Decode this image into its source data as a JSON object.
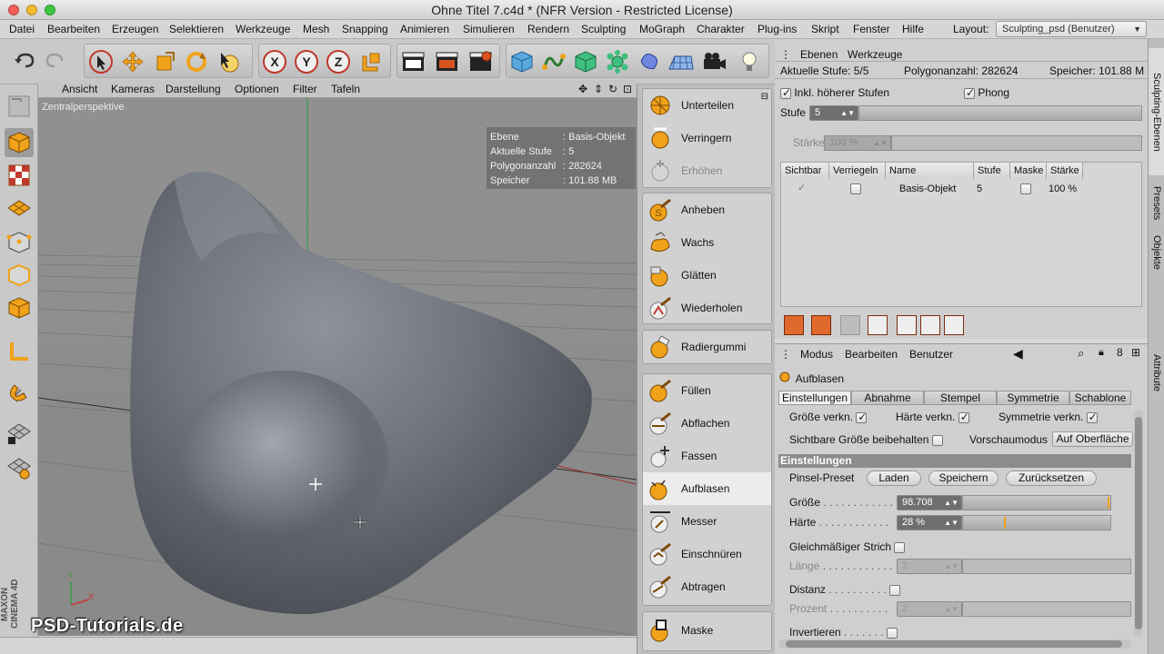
{
  "window": {
    "title": "Ohne Titel 7.c4d * (NFR Version - Restricted License)"
  },
  "menubar": {
    "items": [
      "Datei",
      "Bearbeiten",
      "Erzeugen",
      "Selektieren",
      "Werkzeuge",
      "Mesh",
      "Snapping",
      "Animieren",
      "Simulieren",
      "Rendern",
      "Sculpting",
      "MoGraph",
      "Charakter",
      "Plug-ins",
      "Skript",
      "Fenster",
      "Hilfe"
    ],
    "layout_label": "Layout:",
    "layout_value": "Sculpting_psd (Benutzer)"
  },
  "toolbar": {
    "axis_x": "X",
    "axis_y": "Y",
    "axis_z": "Z"
  },
  "viewport": {
    "menu": [
      "Ansicht",
      "Kameras",
      "Darstellung",
      "Optionen",
      "Filter",
      "Tafeln"
    ],
    "label": "Zentralperspektive",
    "hud": [
      {
        "k": "Ebene",
        "v": ": Basis-Objekt"
      },
      {
        "k": "Aktuelle Stufe",
        "v": ": 5"
      },
      {
        "k": "Polygonanzahl",
        "v": ": 282624"
      },
      {
        "k": "Speicher",
        "v": ": 101.88 MB"
      }
    ],
    "watermark": "PSD-Tutorials.de",
    "maxon": "MAXON CINEMA 4D",
    "axis_y": "Y",
    "axis_x": "X"
  },
  "palette": {
    "items": [
      {
        "label": "Unterteilen",
        "icon": "subdivide-icon"
      },
      {
        "label": "Verringern",
        "icon": "reduce-icon"
      },
      {
        "label": "Erhöhen",
        "icon": "increase-icon"
      },
      {
        "label": "Anheben",
        "icon": "pull-brush-icon"
      },
      {
        "label": "Wachs",
        "icon": "wax-brush-icon"
      },
      {
        "label": "Glätten",
        "icon": "smooth-brush-icon"
      },
      {
        "label": "Wiederholen",
        "icon": "repeat-brush-icon"
      },
      {
        "label": "Radiergummi",
        "icon": "eraser-brush-icon"
      },
      {
        "label": "Füllen",
        "icon": "fill-brush-icon"
      },
      {
        "label": "Abflachen",
        "icon": "flatten-brush-icon"
      },
      {
        "label": "Fassen",
        "icon": "grab-brush-icon"
      },
      {
        "label": "Aufblasen",
        "icon": "inflate-brush-icon"
      },
      {
        "label": "Messer",
        "icon": "knife-brush-icon"
      },
      {
        "label": "Einschnüren",
        "icon": "pinch-brush-icon"
      },
      {
        "label": "Abtragen",
        "icon": "scrape-brush-icon"
      },
      {
        "label": "Maske",
        "icon": "mask-brush-icon"
      }
    ]
  },
  "layers_panel": {
    "tabs": [
      "Ebenen",
      "Werkzeuge"
    ],
    "info": {
      "stufe": "Aktuelle Stufe:  5/5",
      "poly": "Polygonanzahl:  282624",
      "mem": "Speicher:  101.88 M"
    },
    "incl_higher": "Inkl. höherer Stufen",
    "phong": "Phong",
    "stufe_label": "Stufe",
    "stufe_value": "5",
    "staerke_label": "Stärke",
    "staerke_value": "100 %",
    "columns": [
      "Sichtbar",
      "Verriegeln",
      "Name",
      "Stufe",
      "Maske",
      "Stärke"
    ],
    "row": {
      "name": "Basis-Objekt",
      "stufe": "5",
      "staerke": "100 %"
    }
  },
  "attributes": {
    "menu": [
      "Modus",
      "Bearbeiten",
      "Benutzer"
    ],
    "tool_name": "Aufblasen",
    "tabs": [
      "Einstellungen",
      "Abnahme",
      "Stempel",
      "Symmetrie",
      "Schablone"
    ],
    "groesse_verkn": "Größe verkn.",
    "haerte_verkn": "Härte verkn.",
    "sym_verkn": "Symmetrie verkn.",
    "sichtbare": "Sichtbare Größe beibehalten",
    "vorschau": "Vorschaumodus",
    "vorschau_value": "Auf Oberfläche",
    "section": "Einstellungen",
    "preset_label": "Pinsel-Preset",
    "btn_laden": "Laden",
    "btn_speichern": "Speichern",
    "btn_reset": "Zurücksetzen",
    "groesse_label": "Größe",
    "groesse_value": "98.708",
    "haerte_label": "Härte",
    "haerte_value": "28 %",
    "gleich": "Gleichmäßiger Strich",
    "laenge": "Länge",
    "laenge_value": "2",
    "distanz": "Distanz",
    "prozent": "Prozent",
    "prozent_value": "2",
    "invertieren": "Invertieren"
  },
  "sidetabs": {
    "sculpting": "Sculpting-Ebenen",
    "presets": "Presets",
    "objekte": "Objekte",
    "attribute": "Attribute"
  }
}
